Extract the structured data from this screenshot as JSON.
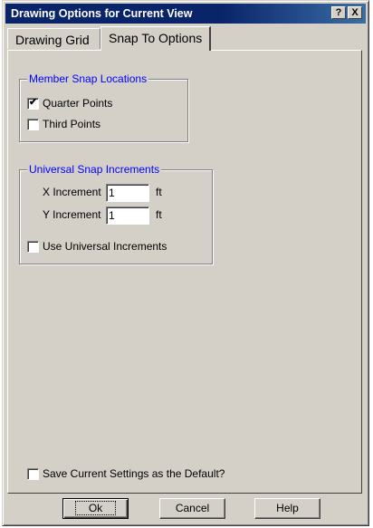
{
  "window": {
    "title": "Drawing Options for Current View",
    "help_glyph": "?",
    "close_glyph": "X"
  },
  "tabs": [
    {
      "label": "Drawing Grid",
      "selected": false
    },
    {
      "label": "Snap To Options",
      "selected": true
    }
  ],
  "member_snap": {
    "legend": "Member Snap Locations",
    "options": [
      {
        "label": "Quarter Points",
        "checked": true
      },
      {
        "label": "Third Points",
        "checked": false
      }
    ]
  },
  "universal_snap": {
    "legend": "Universal Snap Increments",
    "x_label": "X Increment",
    "x_value": "1",
    "x_unit": "ft",
    "y_label": "Y Increment",
    "y_value": "1",
    "y_unit": "ft",
    "use_label": "Use Universal Increments",
    "use_checked": false
  },
  "save_default": {
    "label": "Save Current Settings as the Default?",
    "checked": false
  },
  "buttons": {
    "ok": "Ok",
    "cancel": "Cancel",
    "help": "Help"
  },
  "colors": {
    "title_bar": "#0a246a",
    "face": "#d4d0c8",
    "legend_text": "#0000ff"
  }
}
